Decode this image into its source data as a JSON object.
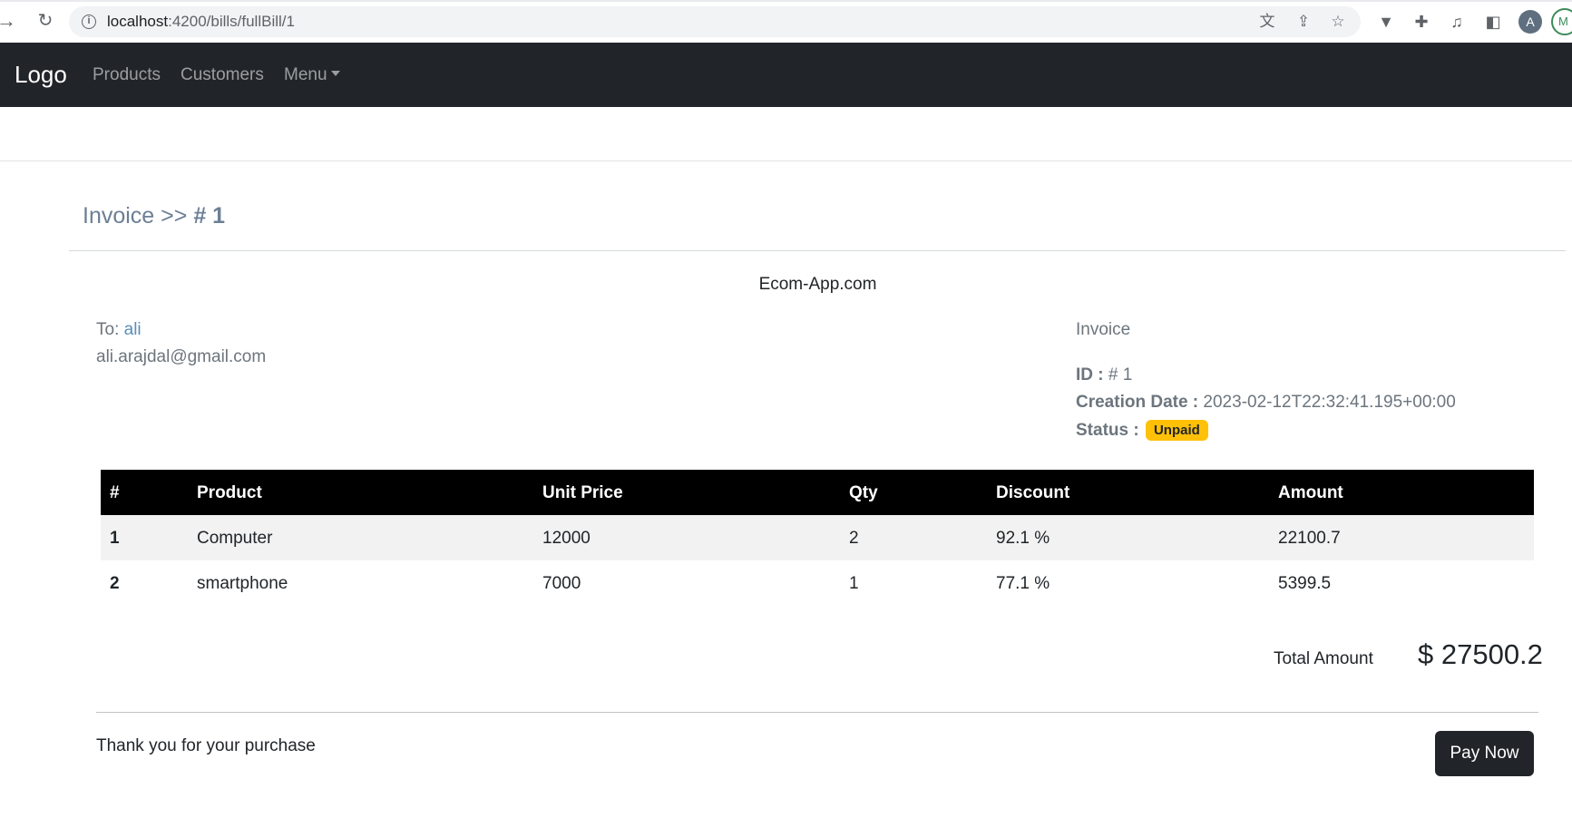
{
  "browser": {
    "url_host": "localhost",
    "url_path": ":4200/bills/fullBill/1",
    "profile_initial": "A",
    "profile_second_initial": "M"
  },
  "navbar": {
    "brand": "Logo",
    "links": [
      "Products",
      "Customers"
    ],
    "menu_label": "Menu"
  },
  "page": {
    "title_prefix": "Invoice >> ",
    "title_number": "# 1"
  },
  "invoice": {
    "company": "Ecom-App.com",
    "to_label": "To: ",
    "to_name": "ali",
    "email": "ali.arajdal@gmail.com",
    "heading": "Invoice",
    "id_label": "ID : ",
    "id_value": "# 1",
    "date_label": "Creation Date : ",
    "date_value": "2023-02-12T22:32:41.195+00:00",
    "status_label": "Status : ",
    "status_value": "Unpaid",
    "status_color": "#ffc107"
  },
  "table": {
    "headers": [
      "#",
      "Product",
      "Unit Price",
      "Qty",
      "Discount",
      "Amount"
    ],
    "rows": [
      [
        "1",
        "Computer",
        "12000",
        "2",
        "92.1 %",
        "22100.7"
      ],
      [
        "2",
        "smartphone",
        "7000",
        "1",
        "77.1 %",
        "5399.5"
      ]
    ]
  },
  "summary": {
    "total_label": "Total Amount",
    "total_value": "$ 27500.2"
  },
  "footer": {
    "thanks": "Thank you for your purchase",
    "pay_button": "Pay Now"
  }
}
